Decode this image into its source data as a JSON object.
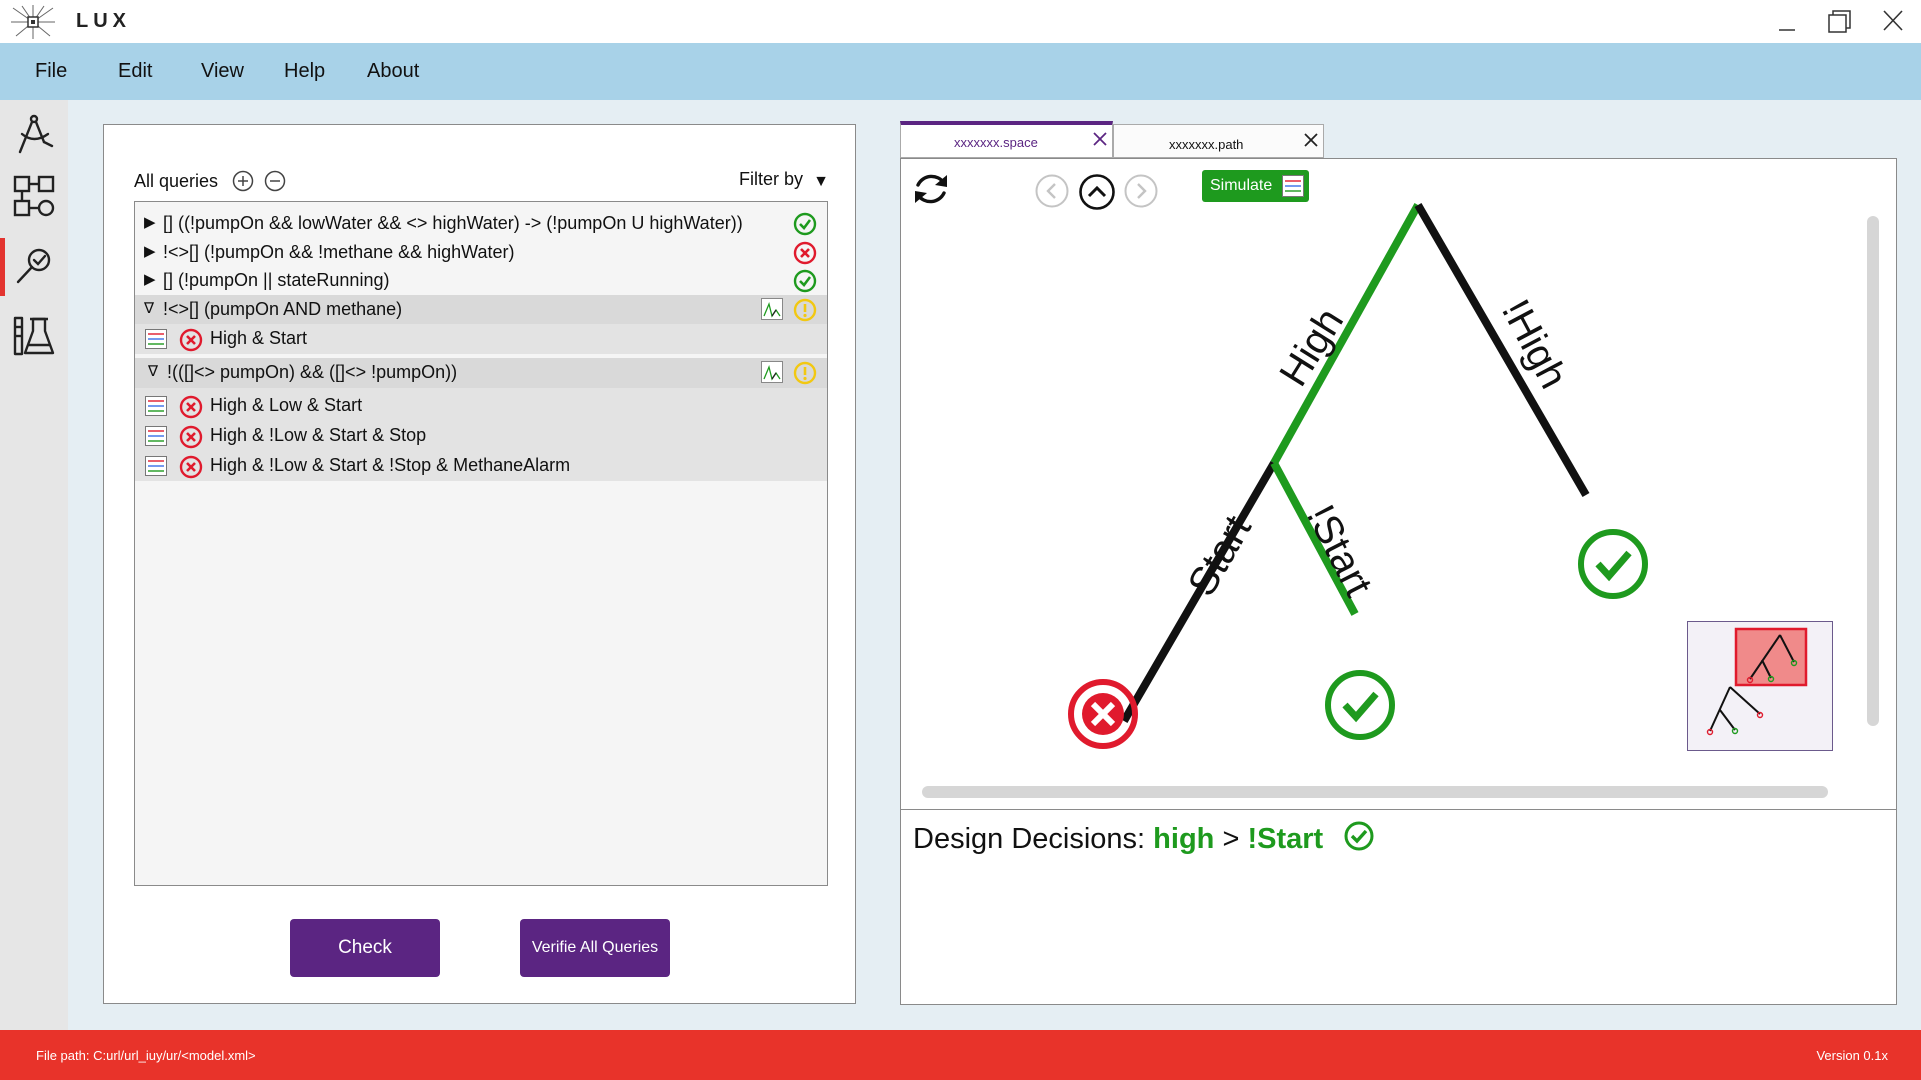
{
  "app": {
    "title": "LUX"
  },
  "menu": {
    "items": [
      "File",
      "Edit",
      "View",
      "Help",
      "About"
    ]
  },
  "queries": {
    "header_label": "All queries",
    "filter_label": "Filter by",
    "rows": [
      {
        "text": "[] ((!pumpOn && lowWater && <> highWater) -> (!pumpOn U highWater))",
        "status": "pass"
      },
      {
        "text": "!<>[] (!pumpOn && !methane && highWater)",
        "status": "fail"
      },
      {
        "text": "[] (!pumpOn || stateRunning)",
        "status": "pass"
      },
      {
        "text": "!<>[] (pumpOn AND methane)",
        "status": "warning",
        "expanded": true
      },
      {
        "text": "High & Start",
        "status": "fail",
        "trace": true
      },
      {
        "text": "!(([]<> pumpOn) && ([]<> !pumpOn))",
        "status": "warning",
        "expanded": true
      },
      {
        "text": "High & Low & Start",
        "status": "fail",
        "trace": true
      },
      {
        "text": "High & !Low & Start & Stop",
        "status": "fail",
        "trace": true
      },
      {
        "text": "High & !Low & Start & !Stop & MethaneAlarm",
        "status": "fail",
        "trace": true
      }
    ],
    "check_label": "Check",
    "verify_all_label": "Verifie All Queries"
  },
  "tabs": [
    {
      "label": "xxxxxxx.space",
      "active": true
    },
    {
      "label": "xxxxxxx.path",
      "active": false
    }
  ],
  "toolbar": {
    "simulate_label": "Simulate"
  },
  "tree": {
    "edges": {
      "high": "High",
      "not_high": "!High",
      "start": "Start",
      "not_start": "!Start"
    }
  },
  "design_decisions": {
    "label": "Design Decisions:",
    "first": "high",
    "separator": ">",
    "second": "!Start"
  },
  "status_bar": {
    "file_path": "File path: C:url/url_iuy/ur/<model.xml>",
    "version": "Version 0.1x"
  },
  "colors": {
    "accent_purple": "#5b2582",
    "menu_blue": "#a8d2e8",
    "status_red": "#e8332a",
    "pass_green": "#1e9a1e",
    "fail_red": "#e01a2d",
    "warn_yellow": "#f2c811"
  },
  "icons": {
    "rail": [
      "compass-icon",
      "diagram-blocks-icon",
      "search-check-icon",
      "flask-icon"
    ],
    "toolbar": [
      "refresh-icon",
      "arrow-left-icon",
      "arrow-up-icon",
      "arrow-right-icon",
      "trace-icon"
    ]
  }
}
